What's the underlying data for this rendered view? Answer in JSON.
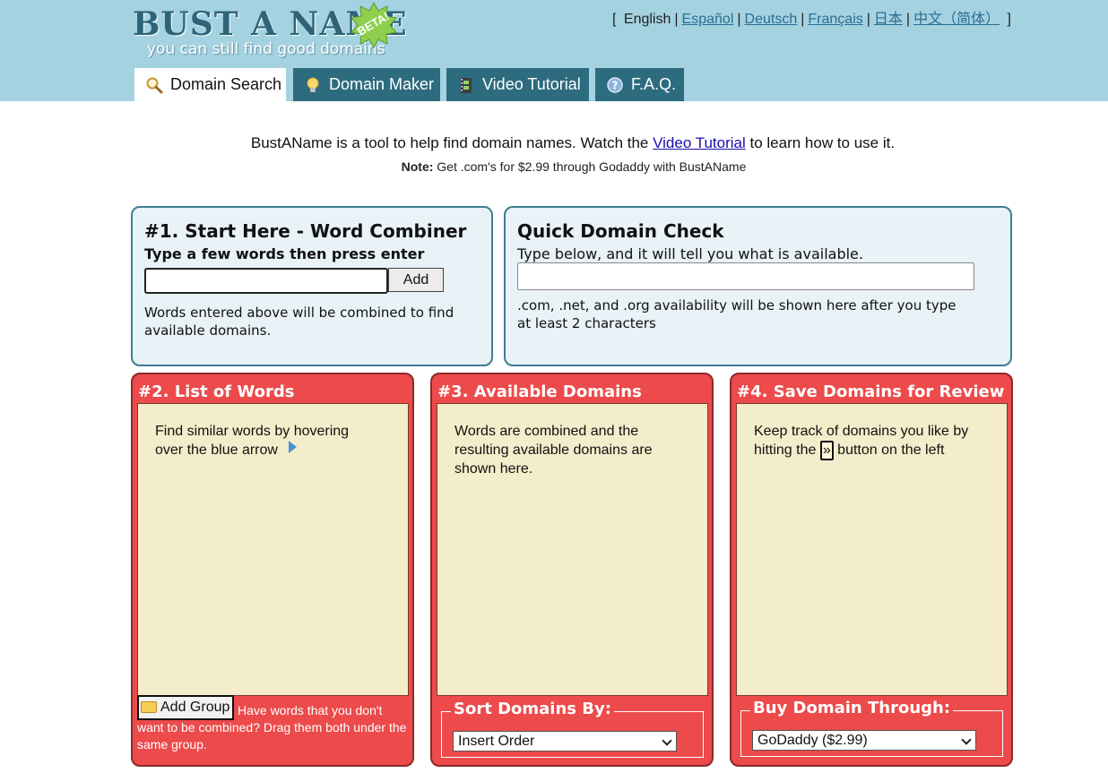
{
  "logo": {
    "title": "BUST A NAME",
    "tagline": "you can still find good domains",
    "badge": "BETA!"
  },
  "languages": {
    "open_bracket": "[",
    "close_bracket": "]",
    "separator": "|",
    "items": [
      {
        "label": "English",
        "current": true
      },
      {
        "label": "Español"
      },
      {
        "label": "Deutsch"
      },
      {
        "label": "Français"
      },
      {
        "label": "日本"
      },
      {
        "label": "中文（简体）"
      }
    ]
  },
  "tabs": [
    {
      "label": "Domain Search",
      "icon": "magnifier-icon",
      "active": true
    },
    {
      "label": "Domain Maker",
      "icon": "lightbulb-icon"
    },
    {
      "label": "Video Tutorial",
      "icon": "film-icon"
    },
    {
      "label": "F.A.Q.",
      "icon": "help-icon"
    }
  ],
  "intro": {
    "before": "BustAName is a tool to help find domain names. Watch the ",
    "link": "Video Tutorial",
    "after": " to learn how to use it."
  },
  "note": {
    "label": "Note:",
    "text": " Get .com's for $2.99 through Godaddy with BustAName"
  },
  "word_combiner": {
    "title": "#1. Start Here - Word Combiner",
    "subtitle": "Type a few words then press enter",
    "input_value": "",
    "add_label": "Add",
    "help": "Words entered above will be combined to find available domains."
  },
  "quick_check": {
    "title": "Quick Domain Check",
    "subtitle": "Type below, and it will tell you what is available.",
    "input_value": "",
    "help": ".com, .net, and .org availability will be shown here after you type at least 2 characters"
  },
  "list_of_words": {
    "title": "#2. List of Words",
    "help": "Find similar words by hovering over the blue arrow",
    "add_group_label": "Add Group",
    "add_group_note": "Have words that you don't want to be combined?  Drag them both under the same group."
  },
  "available_domains": {
    "title": "#3. Available Domains",
    "help": "Words are combined and the resulting available domains are shown here.",
    "sort_legend": "Sort Domains By:",
    "sort_selected": "Insert Order"
  },
  "save_domains": {
    "title": "#4. Save Domains for Review",
    "help_before": "Keep track of domains you like by hitting the ",
    "button_glyph": "»",
    "help_after": " button on the left",
    "buy_legend": "Buy Domain Through:",
    "buy_selected": "GoDaddy ($2.99)"
  },
  "colors": {
    "header_bg": "#a5d2e0",
    "tab_bg": "#2d6b7e",
    "panel_red": "#ec4a4b",
    "panel_cream": "#f4edcb",
    "box_blue": "#e8f2f7"
  }
}
